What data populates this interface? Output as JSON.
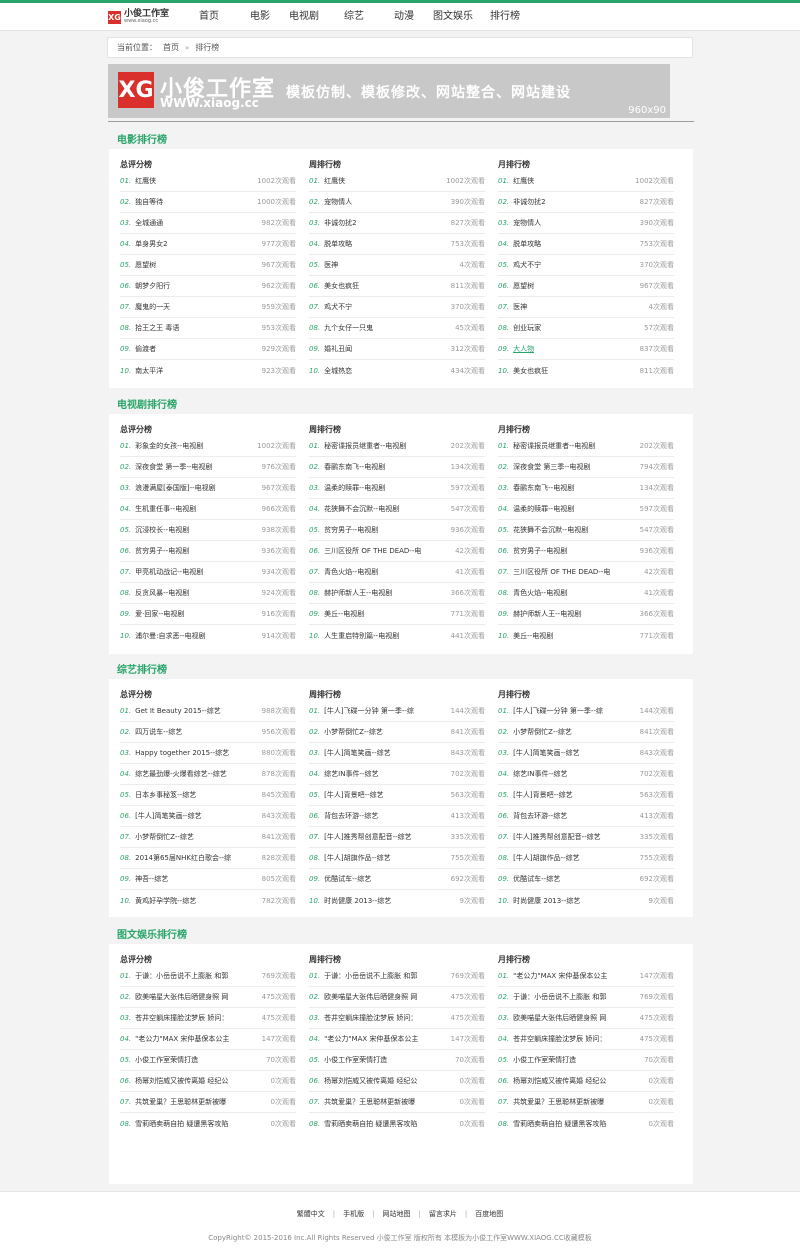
{
  "header": {
    "logo_mark": "XG",
    "logo_cn": "小俊工作室",
    "logo_en": "www.xiaog.cc",
    "nav": [
      "首页",
      "电影",
      "电视剧",
      "综艺",
      "动漫",
      "图文娱乐",
      "排行榜"
    ]
  },
  "breadcrumb": {
    "label": "当前位置：",
    "home": "首页",
    "sep": "»",
    "current": "排行榜"
  },
  "banner": {
    "logo_mark": "XG",
    "cn": "小俊工作室",
    "en": "WWW.xiaog.cc",
    "slogan": "模板仿制、模板修改、网站整合、网站建设",
    "size": "960x90"
  },
  "sections": [
    {
      "title": "电影排行榜",
      "columns": [
        {
          "head": "总评分榜",
          "items": [
            {
              "num": "01.",
              "name": "红鹰侠",
              "views": "1002次观看"
            },
            {
              "num": "02.",
              "name": "独自等待",
              "views": "1000次观看"
            },
            {
              "num": "03.",
              "name": "全城通通",
              "views": "982次观看"
            },
            {
              "num": "04.",
              "name": "单身男女2",
              "views": "977次观看"
            },
            {
              "num": "05.",
              "name": "愿望树",
              "views": "967次观看"
            },
            {
              "num": "06.",
              "name": "朝梦夕阳行",
              "views": "962次观看"
            },
            {
              "num": "07.",
              "name": "魔鬼的一天",
              "views": "959次观看"
            },
            {
              "num": "08.",
              "name": "拾王之王 毒语",
              "views": "953次观看"
            },
            {
              "num": "09.",
              "name": "偷渡者",
              "views": "929次观看"
            },
            {
              "num": "10.",
              "name": "南太平洋",
              "views": "923次观看"
            }
          ]
        },
        {
          "head": "周排行榜",
          "items": [
            {
              "num": "01.",
              "name": "红鹰侠",
              "views": "1002次观看"
            },
            {
              "num": "02.",
              "name": "宠物情人",
              "views": "390次观看"
            },
            {
              "num": "03.",
              "name": "非诚勿扰2",
              "views": "827次观看"
            },
            {
              "num": "04.",
              "name": "脱单攻略",
              "views": "753次观看"
            },
            {
              "num": "05.",
              "name": "医神",
              "views": "4次观看"
            },
            {
              "num": "06.",
              "name": "美女也疯狂",
              "views": "811次观看"
            },
            {
              "num": "07.",
              "name": "鸡犬不宁",
              "views": "370次观看"
            },
            {
              "num": "08.",
              "name": "九个女仔一只鬼",
              "views": "45次观看"
            },
            {
              "num": "09.",
              "name": "婚礼丑闻",
              "views": "312次观看"
            },
            {
              "num": "10.",
              "name": "全城热恋",
              "views": "434次观看"
            }
          ]
        },
        {
          "head": "月排行榜",
          "items": [
            {
              "num": "01.",
              "name": "红鹰侠",
              "views": "1002次观看"
            },
            {
              "num": "02.",
              "name": "非诚勿扰2",
              "views": "827次观看"
            },
            {
              "num": "03.",
              "name": "宠物情人",
              "views": "390次观看"
            },
            {
              "num": "04.",
              "name": "脱单攻略",
              "views": "753次观看"
            },
            {
              "num": "05.",
              "name": "鸡犬不宁",
              "views": "370次观看"
            },
            {
              "num": "06.",
              "name": "愿望树",
              "views": "967次观看"
            },
            {
              "num": "07.",
              "name": "医神",
              "views": "4次观看"
            },
            {
              "num": "08.",
              "name": "创业玩家",
              "views": "57次观看"
            },
            {
              "num": "09.",
              "name": "大人物",
              "views": "837次观看",
              "hl": true
            },
            {
              "num": "10.",
              "name": "美女也疯狂",
              "views": "811次观看"
            }
          ]
        }
      ]
    },
    {
      "title": "电视剧排行榜",
      "columns": [
        {
          "head": "总评分榜",
          "items": [
            {
              "num": "01.",
              "name": "彩象金的女孩--电视剧",
              "views": "1002次观看"
            },
            {
              "num": "02.",
              "name": "深夜食堂 第一季--电视剧",
              "views": "976次观看"
            },
            {
              "num": "03.",
              "name": "浪漫满屋[泰国版]--电视剧",
              "views": "967次观看"
            },
            {
              "num": "04.",
              "name": "生机重任事--电视剧",
              "views": "966次观看"
            },
            {
              "num": "05.",
              "name": "沉浸校长--电视剧",
              "views": "938次观看"
            },
            {
              "num": "06.",
              "name": "贫穷男子--电视剧",
              "views": "936次观看"
            },
            {
              "num": "07.",
              "name": "甲亮机动战记--电视剧",
              "views": "934次观看"
            },
            {
              "num": "08.",
              "name": "反贪风暴--电视剧",
              "views": "924次观看"
            },
            {
              "num": "09.",
              "name": "爱·回家--电视剧",
              "views": "916次观看"
            },
            {
              "num": "10.",
              "name": "浦尔曼:自求恶--电视剧",
              "views": "914次观看"
            }
          ]
        },
        {
          "head": "周排行榜",
          "items": [
            {
              "num": "01.",
              "name": "秘密谍报员继重者--电视剧",
              "views": "202次观看"
            },
            {
              "num": "02.",
              "name": "春鹂东南飞--电视剧",
              "views": "134次观看"
            },
            {
              "num": "03.",
              "name": "温柔的赎罪--电视剧",
              "views": "597次观看"
            },
            {
              "num": "04.",
              "name": "花狭舞不会沉默--电视剧",
              "views": "547次观看"
            },
            {
              "num": "05.",
              "name": "贫穷男子--电视剧",
              "views": "936次观看"
            },
            {
              "num": "06.",
              "name": "三川区役所 OF THE DEAD--电",
              "views": "42次观看"
            },
            {
              "num": "07.",
              "name": "青色火焰--电视剧",
              "views": "41次观看"
            },
            {
              "num": "08.",
              "name": "赫护师新人王--电视剧",
              "views": "366次观看"
            },
            {
              "num": "09.",
              "name": "美丘--电视剧",
              "views": "771次观看"
            },
            {
              "num": "10.",
              "name": "人生重启特别篇--电视剧",
              "views": "441次观看"
            }
          ]
        },
        {
          "head": "月排行榜",
          "items": [
            {
              "num": "01.",
              "name": "秘密谍报员继重者--电视剧",
              "views": "202次观看"
            },
            {
              "num": "02.",
              "name": "深夜食堂 第三季--电视剧",
              "views": "794次观看"
            },
            {
              "num": "03.",
              "name": "春鹂东南飞--电视剧",
              "views": "134次观看"
            },
            {
              "num": "04.",
              "name": "温柔的赎罪--电视剧",
              "views": "597次观看"
            },
            {
              "num": "05.",
              "name": "花狭舞不会沉默--电视剧",
              "views": "547次观看"
            },
            {
              "num": "06.",
              "name": "贫穷男子--电视剧",
              "views": "936次观看"
            },
            {
              "num": "07.",
              "name": "三川区役所 OF THE DEAD--电",
              "views": "42次观看"
            },
            {
              "num": "08.",
              "name": "青色火焰--电视剧",
              "views": "41次观看"
            },
            {
              "num": "09.",
              "name": "赫护师新人王--电视剧",
              "views": "366次观看"
            },
            {
              "num": "10.",
              "name": "美丘--电视剧",
              "views": "771次观看"
            }
          ]
        }
      ]
    },
    {
      "title": "综艺排行榜",
      "columns": [
        {
          "head": "总评分榜",
          "items": [
            {
              "num": "01.",
              "name": "Get It Beauty 2015--综艺",
              "views": "988次观看"
            },
            {
              "num": "02.",
              "name": "四万说车--综艺",
              "views": "956次观看"
            },
            {
              "num": "03.",
              "name": "Happy together 2015--综艺",
              "views": "880次观看"
            },
            {
              "num": "04.",
              "name": "综艺最劲爆-火爆看综艺--综艺",
              "views": "878次观看"
            },
            {
              "num": "05.",
              "name": "日本乡事秘笈--综艺",
              "views": "845次观看"
            },
            {
              "num": "06.",
              "name": "[牛人]简笔笑画--综艺",
              "views": "843次观看"
            },
            {
              "num": "07.",
              "name": "小梦帮倒忙Z--综艺",
              "views": "841次观看"
            },
            {
              "num": "08.",
              "name": "2014第65届NHK红白歌会--综",
              "views": "828次观看"
            },
            {
              "num": "09.",
              "name": "神吾--综艺",
              "views": "805次观看"
            },
            {
              "num": "10.",
              "name": "黄鸡好孕学院--综艺",
              "views": "782次观看"
            }
          ]
        },
        {
          "head": "周排行榜",
          "items": [
            {
              "num": "01.",
              "name": "[牛人]飞碟一分钟 第一季--综",
              "views": "144次观看"
            },
            {
              "num": "02.",
              "name": "小梦帮倒忙Z--综艺",
              "views": "841次观看"
            },
            {
              "num": "03.",
              "name": "[牛人]简笔笑画--综艺",
              "views": "843次观看"
            },
            {
              "num": "04.",
              "name": "综艺IN事件--综艺",
              "views": "702次观看"
            },
            {
              "num": "05.",
              "name": "[牛人]背景吧--综艺",
              "views": "563次观看"
            },
            {
              "num": "06.",
              "name": "背包去环游--综艺",
              "views": "413次观看"
            },
            {
              "num": "07.",
              "name": "[牛人]推秀帮创意配音--综艺",
              "views": "335次观看"
            },
            {
              "num": "08.",
              "name": "[牛人]胡旗作品--综艺",
              "views": "755次观看"
            },
            {
              "num": "09.",
              "name": "优酷试车--综艺",
              "views": "692次观看"
            },
            {
              "num": "10.",
              "name": "时尚健康 2013--综艺",
              "views": "9次观看"
            }
          ]
        },
        {
          "head": "月排行榜",
          "items": [
            {
              "num": "01.",
              "name": "[牛人]飞碟一分钟 第一季--综",
              "views": "144次观看"
            },
            {
              "num": "02.",
              "name": "小梦帮倒忙Z--综艺",
              "views": "841次观看"
            },
            {
              "num": "03.",
              "name": "[牛人]简笔笑画--综艺",
              "views": "843次观看"
            },
            {
              "num": "04.",
              "name": "综艺IN事件--综艺",
              "views": "702次观看"
            },
            {
              "num": "05.",
              "name": "[牛人]背景吧--综艺",
              "views": "563次观看"
            },
            {
              "num": "06.",
              "name": "背包去环游--综艺",
              "views": "413次观看"
            },
            {
              "num": "07.",
              "name": "[牛人]推秀帮创意配音--综艺",
              "views": "335次观看"
            },
            {
              "num": "08.",
              "name": "[牛人]胡旗作品--综艺",
              "views": "755次观看"
            },
            {
              "num": "09.",
              "name": "优酷试车--综艺",
              "views": "692次观看"
            },
            {
              "num": "10.",
              "name": "时尚健康 2013--综艺",
              "views": "9次观看"
            }
          ]
        }
      ]
    },
    {
      "title": "图文娱乐排行榜",
      "columns": [
        {
          "head": "总评分榜",
          "items": [
            {
              "num": "01.",
              "name": "于谦：小岳岳说不上膨胀 和郭",
              "views": "769次观看"
            },
            {
              "num": "02.",
              "name": "欧美喵星大张伟后晒健身照 网",
              "views": "475次观看"
            },
            {
              "num": "03.",
              "name": "苍井空躺床撞脸沈梦辰 娇问：",
              "views": "475次观看"
            },
            {
              "num": "04.",
              "name": "\"老公力\"MAX 宋仲基保本公主",
              "views": "147次观看"
            },
            {
              "num": "05.",
              "name": "小俊工作室荣情打造",
              "views": "70次观看"
            },
            {
              "num": "06.",
              "name": "杨幂刘恺威又被传离婚 经纪公",
              "views": "0次观看"
            },
            {
              "num": "07.",
              "name": "共筑爱巢？王思聪林更新被曝",
              "views": "0次观看"
            },
            {
              "num": "08.",
              "name": "雪莉晒卖萌自拍 疑遭黑客攻陷",
              "views": "0次观看"
            }
          ]
        },
        {
          "head": "周排行榜",
          "items": [
            {
              "num": "01.",
              "name": "于谦：小岳岳说不上膨胀 和郭",
              "views": "769次观看"
            },
            {
              "num": "02.",
              "name": "欧美喵星大张伟后晒健身照 网",
              "views": "475次观看"
            },
            {
              "num": "03.",
              "name": "苍井空躺床撞脸沈梦辰 娇问：",
              "views": "475次观看"
            },
            {
              "num": "04.",
              "name": "\"老公力\"MAX 宋仲基保本公主",
              "views": "147次观看"
            },
            {
              "num": "05.",
              "name": "小俊工作室荣情打造",
              "views": "70次观看"
            },
            {
              "num": "06.",
              "name": "杨幂刘恺威又被传离婚 经纪公",
              "views": "0次观看"
            },
            {
              "num": "07.",
              "name": "共筑爱巢？王思聪林更新被曝",
              "views": "0次观看"
            },
            {
              "num": "08.",
              "name": "雪莉晒卖萌自拍 疑遭黑客攻陷",
              "views": "0次观看"
            }
          ]
        },
        {
          "head": "月排行榜",
          "items": [
            {
              "num": "01.",
              "name": "\"老公力\"MAX 宋仲基保本公主",
              "views": "147次观看"
            },
            {
              "num": "02.",
              "name": "于谦：小岳岳说不上膨胀 和郭",
              "views": "769次观看"
            },
            {
              "num": "03.",
              "name": "欧美喵星大张伟后晒健身照 网",
              "views": "475次观看"
            },
            {
              "num": "04.",
              "name": "苍井空躺床撞脸沈梦辰 娇问：",
              "views": "475次观看"
            },
            {
              "num": "05.",
              "name": "小俊工作室荣情打造",
              "views": "70次观看"
            },
            {
              "num": "06.",
              "name": "杨幂刘恺威又被传离婚 经纪公",
              "views": "0次观看"
            },
            {
              "num": "07.",
              "name": "共筑爱巢？王思聪林更新被曝",
              "views": "0次观看"
            },
            {
              "num": "08.",
              "name": "雪莉晒卖萌自拍 疑遭黑客攻陷",
              "views": "0次观看"
            }
          ]
        }
      ]
    }
  ],
  "footer": {
    "links": [
      "繁體中文",
      "手机版",
      "网站地图",
      "留言求片",
      "百度地图"
    ],
    "sep": "|",
    "copyright": "CopyRight© 2015-2016 Inc.All Rights Reserved 小俊工作室 版权所有 本模板为小俊工作室WWW.XIAOG.CC收藏模板"
  }
}
